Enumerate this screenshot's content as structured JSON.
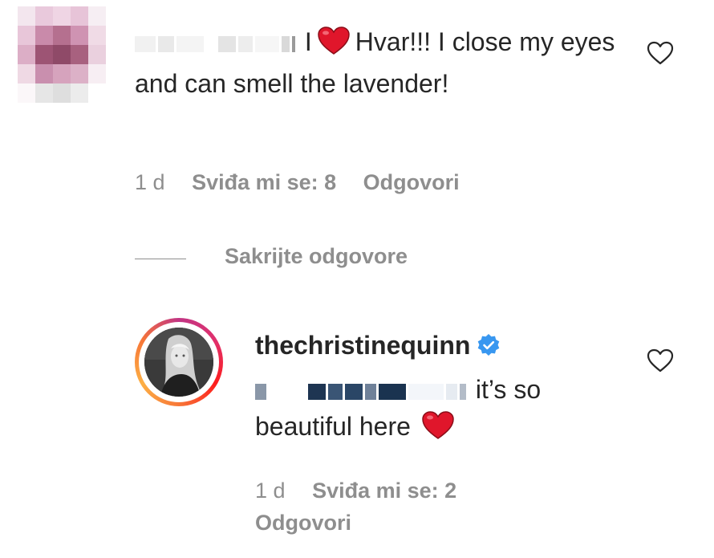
{
  "comment": {
    "text_tail": "Hvar!!! I close my eyes and can smell the lavender!",
    "time": "1 d",
    "likes": "Sviđa mi se: 8",
    "reply_label": "Odgovori",
    "heart_icon": "red-heart-emoji",
    "like_icon": "heart-outline-icon"
  },
  "thread": {
    "hide_replies_label": "Sakrijte odgovore"
  },
  "reply": {
    "username": "thechristinequinn",
    "verified_icon": "verified-badge-icon",
    "text_part1": "it’s so",
    "text_part2": "beautiful here",
    "heart_icon": "red-heart-emoji",
    "time": "1 d",
    "likes": "Sviđa mi se: 2",
    "reply_label": "Odgovori",
    "like_icon": "heart-outline-icon"
  },
  "colors": {
    "text": "#262626",
    "muted": "#8e8e8e",
    "heart_red": "#e0162b",
    "verified_blue": "#3897f0"
  }
}
